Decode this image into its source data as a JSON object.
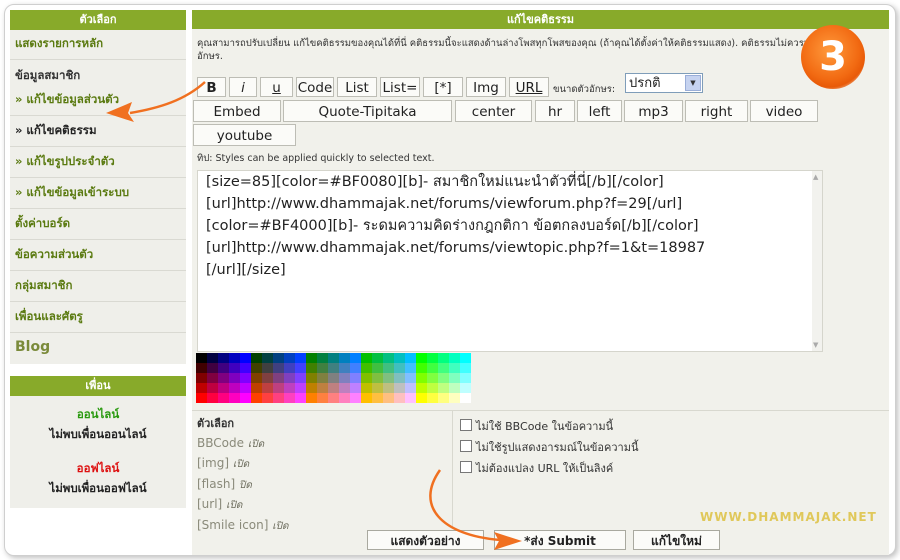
{
  "sidebar": {
    "header": "ตัวเลือก",
    "items": [
      {
        "label": "แสดงรายการหลัก"
      },
      {
        "label": "ข้อมูลสมาชิก"
      },
      {
        "label": "» แก้ไขข้อมูลส่วนตัว"
      },
      {
        "label": "» แก้ไขคติธรรม"
      },
      {
        "label": "» แก้ไขรูปประจำตัว"
      },
      {
        "label": "» แก้ไขข้อมูลเข้าระบบ"
      },
      {
        "label": "ตั้งค่าบอร์ด"
      },
      {
        "label": "ข้อความส่วนตัว"
      },
      {
        "label": "กลุ่มสมาชิก"
      },
      {
        "label": "เพื่อนและศัตรู"
      },
      {
        "label": "Blog"
      }
    ]
  },
  "friends": {
    "header": "เพื่อน",
    "online_label": "ออนไลน์",
    "online_none": "ไม่พบเพื่อนออนไลน์",
    "offline_label": "ออฟไลน์",
    "offline_none": "ไม่พบเพื่อนออฟไลน์"
  },
  "main": {
    "header": "แก้ไขคติธรรม",
    "intro": "คุณสามารถปรับเปลี่ยน แก้ไขคติธรรมของคุณได้ที่นี่ คติธรรมนี้จะแสดงด้านล่างโพสทุกโพสของคุณ (ถ้าคุณได้ตั้งค่าให้คติธรรมแสดง). คติธรรมไม่ควรเกิน 500 ตัวอักษร.",
    "toolbar": {
      "bold": "B",
      "italic": "i",
      "underline": "u",
      "code": "Code",
      "list": "List",
      "list_eq": "List=",
      "star": "[*]",
      "img": "Img",
      "url": "URL",
      "font_size_label": "ขนาดตัวอักษร:",
      "font_size_value": "ปรกติ",
      "embed": "Embed",
      "quote": "Quote-Tipitaka",
      "center": "center",
      "hr": "hr",
      "left": "left",
      "mp3": "mp3",
      "right": "right",
      "video": "video",
      "youtube": "youtube"
    },
    "tip": "ทิป: Styles can be applied quickly to selected text.",
    "editor_text": "[size=85][color=#BF0080][b]- สมาชิกใหม่แนะนำตัวที่นี่[/b][/color]\n[url]http://www.dhammajak.net/forums/viewforum.php?f=29[/url]\n[color=#BF4000][b]- ระดมความคิดร่างกฎกติกา ข้อตกลงบอร์ด[/b][/color]\n[url]http://www.dhammajak.net/forums/viewtopic.php?f=1&t=18987\n[/url][/size]",
    "options": {
      "title": "ตัวเลือก",
      "bbcode": "BBCode",
      "img": "[img]",
      "flash": "[flash]",
      "url": "[url]",
      "smile": "[Smile icon]",
      "state_on": "เปิด",
      "state_off": "ปิด"
    },
    "checks": [
      "ไม่ใช้ BBCode ในข้อความนี้",
      "ไม่ใช้รูปแสดงอารมณ์ในข้อความนี้",
      "ไม่ต้องแปลง URL ให้เป็นลิงค์"
    ],
    "buttons": {
      "preview": "แสดงตัวอย่าง",
      "submit": "*ส่ง Submit",
      "reset": "แก้ไขใหม่"
    },
    "watermark": "WWW.DHAMMAJAK.NET",
    "step_badge": "3"
  },
  "colors": {
    "accent": "#88aa2a",
    "arrow": "#f07020",
    "online": "#2a9a10",
    "offline": "#dd1010"
  }
}
